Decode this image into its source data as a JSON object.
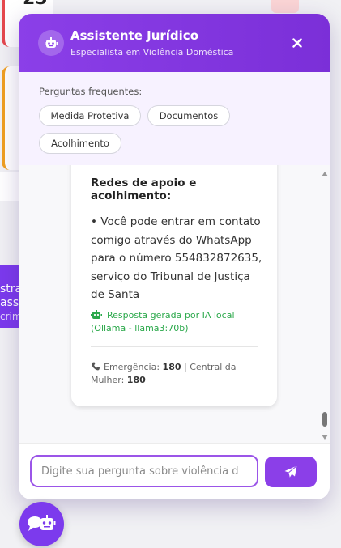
{
  "background": {
    "card_number": "25",
    "purple_banner_lines": [
      "stra",
      "asso",
      "crim"
    ]
  },
  "chat": {
    "title": "Assistente Jurídico",
    "subtitle": "Especialista em Violência Doméstica",
    "close_icon": "×",
    "faq_label": "Perguntas frequentes:",
    "faq_chips": [
      "Medida Protetiva",
      "Documentos",
      "Acolhimento"
    ],
    "message": {
      "heading": "Redes de apoio e acolhimento:",
      "body": "• Você pode entrar em contato comigo através do WhatsApp para o número 554832872635, serviço do Tribunal de Justiça de Santa",
      "ai_note_line1": "Resposta gerada por IA local",
      "ai_note_line2": "(Ollama - llama3:70b)",
      "emergency_label": "Emergência:",
      "emergency_number": "180",
      "separator": "|",
      "central_label": "Central da Mulher:",
      "central_number": "180"
    },
    "input": {
      "value": "",
      "placeholder": "Digite sua pergunta sobre violência d"
    }
  },
  "colors": {
    "accent": "#8b3fe8",
    "ai_note": "#2aa84a"
  }
}
